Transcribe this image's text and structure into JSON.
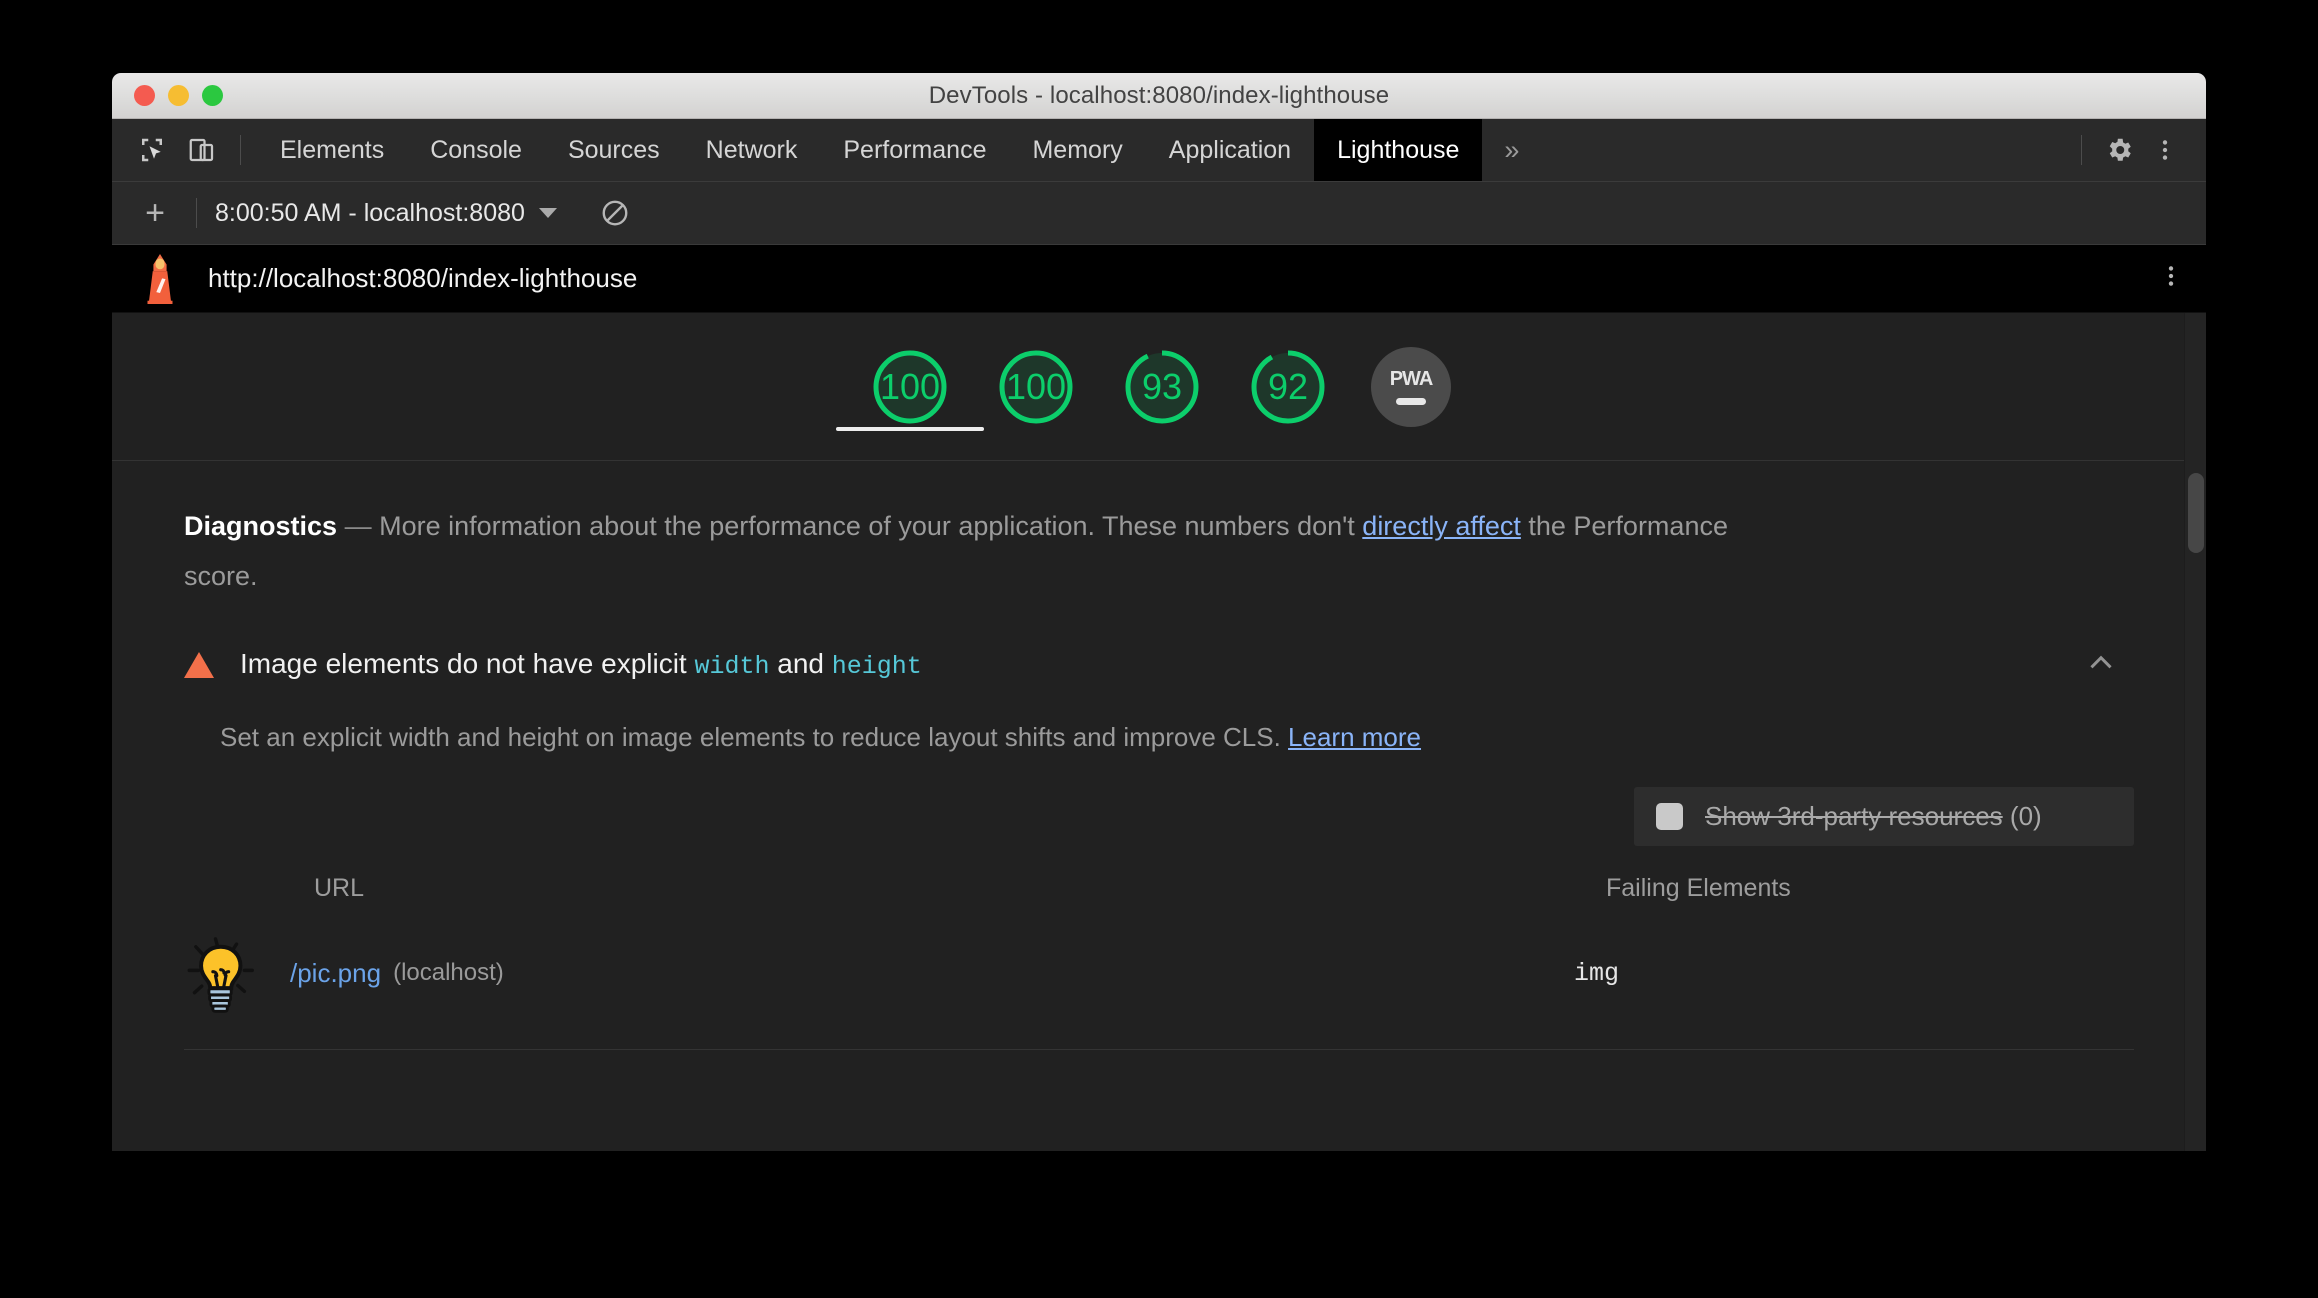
{
  "window": {
    "title": "DevTools - localhost:8080/index-lighthouse",
    "traffic_lights": [
      "close",
      "minimize",
      "zoom"
    ]
  },
  "devtools_tabbar": {
    "inspect_icon": "inspect-cursor-icon",
    "device_icon": "device-toolbar-icon",
    "tabs": [
      {
        "label": "Elements",
        "selected": false
      },
      {
        "label": "Console",
        "selected": false
      },
      {
        "label": "Sources",
        "selected": false
      },
      {
        "label": "Network",
        "selected": false
      },
      {
        "label": "Performance",
        "selected": false
      },
      {
        "label": "Memory",
        "selected": false
      },
      {
        "label": "Application",
        "selected": false
      },
      {
        "label": "Lighthouse",
        "selected": true
      }
    ],
    "more_tabs_label": "»",
    "settings_icon": "gear-icon",
    "menu_icon": "kebab-menu-icon"
  },
  "lighthouse_toolbar": {
    "add_label": "+",
    "run_selected": "8:00:50 AM - localhost:8080",
    "dropdown_icon": "chevron-down-icon",
    "clear_icon": "clear-all-icon"
  },
  "report_header": {
    "logo_icon": "lighthouse-logo-icon",
    "url": "http://localhost:8080/index-lighthouse",
    "menu_icon": "kebab-menu-icon"
  },
  "scores": {
    "gauges": [
      {
        "name": "performance",
        "value": "100",
        "score": 100,
        "color": "#0cce6b",
        "selected": true
      },
      {
        "name": "accessibility",
        "value": "100",
        "score": 100,
        "color": "#0cce6b",
        "selected": false
      },
      {
        "name": "best-practices",
        "value": "93",
        "score": 93,
        "color": "#0cce6b",
        "selected": false
      },
      {
        "name": "seo",
        "value": "92",
        "score": 92,
        "color": "#0cce6b",
        "selected": false
      }
    ],
    "pwa": {
      "label": "PWA",
      "state": "null",
      "color": "#4b4b4b"
    }
  },
  "diagnostics": {
    "heading": "Diagnostics",
    "dash": "—",
    "text_before_link": "More information about the performance of your application. These numbers don't ",
    "link_text": "directly affect",
    "text_after_link": " the Performance score."
  },
  "audit": {
    "severity_icon": "warning-triangle-icon",
    "severity_color": "#f2704a",
    "title_prefix": "Image elements do not have explicit ",
    "code_1": "width",
    "title_middle": " and ",
    "code_2": "height",
    "collapse_icon": "chevron-up-icon",
    "description": "Set an explicit width and height on image elements to reduce layout shifts and improve CLS. ",
    "learn_more": "Learn more",
    "third_party": {
      "checkbox_state": "unchecked",
      "label": "Show 3rd-party resources",
      "count": "(0)"
    },
    "table": {
      "columns": [
        "URL",
        "Failing Elements"
      ],
      "rows": [
        {
          "thumbnail_icon": "lightbulb-thumbnail-icon",
          "url": "/pic.png",
          "host": "(localhost)",
          "failing_element": "img"
        }
      ]
    }
  },
  "scrollbar": {
    "orientation": "vertical"
  }
}
